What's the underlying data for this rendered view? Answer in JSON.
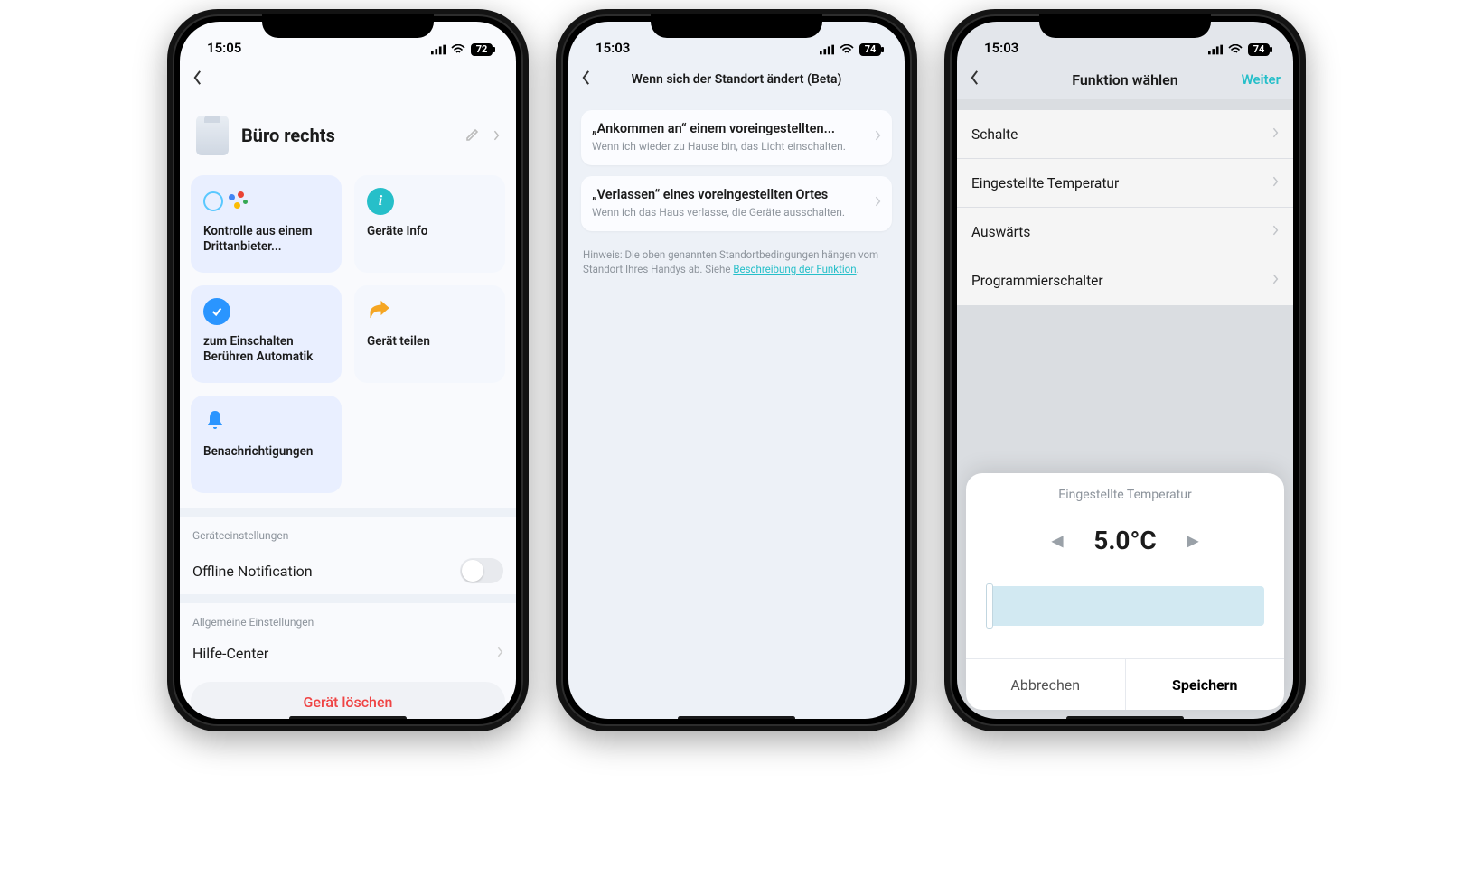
{
  "status": {
    "time1": "15:05",
    "time2": "15:03",
    "time3": "15:03",
    "batt1": "72",
    "batt2": "74",
    "batt3": "74"
  },
  "screen1": {
    "device_name": "Büro rechts",
    "cards": {
      "third_party": "Kontrolle aus einem Drittanbieter...",
      "device_info": "Geräte Info",
      "tap_to_run": "zum Einschalten Berühren Automatik",
      "share": "Gerät teilen",
      "notifications": "Benachrichtigungen"
    },
    "section_device_settings": "Geräteeinstellungen",
    "offline_notification": "Offline Notification",
    "section_general": "Allgemeine Einstellungen",
    "help_center": "Hilfe-Center",
    "delete": "Gerät löschen"
  },
  "screen2": {
    "title": "Wenn sich der Standort ändert (Beta)",
    "arrive": {
      "title": "„Ankommen an“ einem voreingestellten...",
      "sub": "Wenn ich wieder zu Hause bin, das Licht einschalten."
    },
    "leave": {
      "title": "„Verlassen“ eines voreingestellten Ortes",
      "sub": "Wenn ich das Haus verlasse, die Geräte ausschalten."
    },
    "hint_a": "Hinweis: Die oben genannten Standortbedingungen hängen vom Standort Ihres Handys ab. Siehe ",
    "hint_link": "Beschreibung der Funktion",
    "hint_b": "."
  },
  "screen3": {
    "title": "Funktion wählen",
    "next": "Weiter",
    "rows": {
      "switch": "Schalte",
      "temp": "Eingestellte Temperatur",
      "away": "Auswärts",
      "prog": "Programmierschalter"
    },
    "sheet": {
      "title": "Eingestellte Temperatur",
      "value": "5.0°C",
      "cancel": "Abbrechen",
      "save": "Speichern"
    }
  }
}
